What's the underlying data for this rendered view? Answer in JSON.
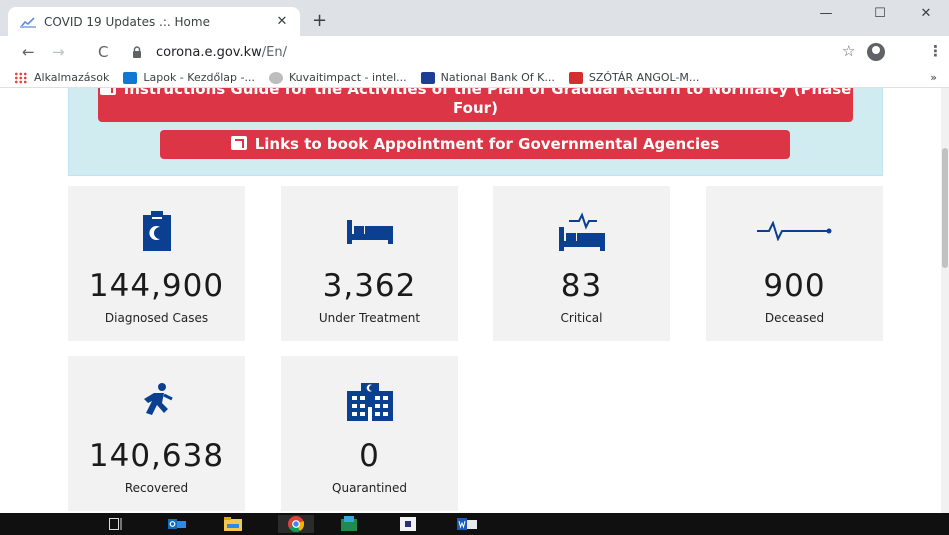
{
  "browser": {
    "tab_title": "COVID 19 Updates .:. Home",
    "tab_close": "✕",
    "new_tab": "+",
    "url_host": "corona.e.gov.kw",
    "url_path": "/En/",
    "window_controls": {
      "minimize": "—",
      "maximize": "☐",
      "close": "✕"
    },
    "nav": {
      "back": "←",
      "forward": "→",
      "reload": "C"
    },
    "star": "☆",
    "menu": "⋮"
  },
  "bookmarks": {
    "items": [
      {
        "label": "Alkalmazások",
        "icon": "apps-grid-icon",
        "color": "#1a73e8"
      },
      {
        "label": "Lapok - Kezdőlap -...",
        "icon": "sharepoint-icon",
        "color": "#0f78d4"
      },
      {
        "label": "Kuvaitimpact - intel...",
        "icon": "globe-icon",
        "color": "#bdbdbd"
      },
      {
        "label": "National Bank Of K...",
        "icon": "nbk-camel-icon",
        "color": "#1c3f95"
      },
      {
        "label": "SZÓTÁR ANGOL-M...",
        "icon": "dictionary-icon",
        "color": "#d32f2f"
      }
    ],
    "more": "»"
  },
  "page": {
    "instructions_button": "Instructions Guide for the Activities of the Plan of Gradual Return to Normalcy (Phase Four)",
    "links_button": "Links to book Appointment for Governmental Agencies",
    "accent_color": "#dc3545",
    "icon_color": "#0b3f8f",
    "stats": [
      {
        "value": "144,900",
        "label": "Diagnosed Cases",
        "icon": "clipboard-icon"
      },
      {
        "value": "3,362",
        "label": "Under Treatment",
        "icon": "bed-icon"
      },
      {
        "value": "83",
        "label": "Critical",
        "icon": "bed-pulse-icon"
      },
      {
        "value": "900",
        "label": "Deceased",
        "icon": "pulse-line-icon"
      },
      {
        "value": "140,638",
        "label": "Recovered",
        "icon": "walking-person-icon"
      },
      {
        "value": "0",
        "label": "Quarantined",
        "icon": "hospital-building-icon"
      }
    ]
  },
  "taskbar": {
    "items": [
      "task-view-icon",
      "outlook-icon",
      "file-explorer-icon",
      "chrome-icon",
      "edge-icon",
      "app-icon",
      "word-icon"
    ]
  }
}
